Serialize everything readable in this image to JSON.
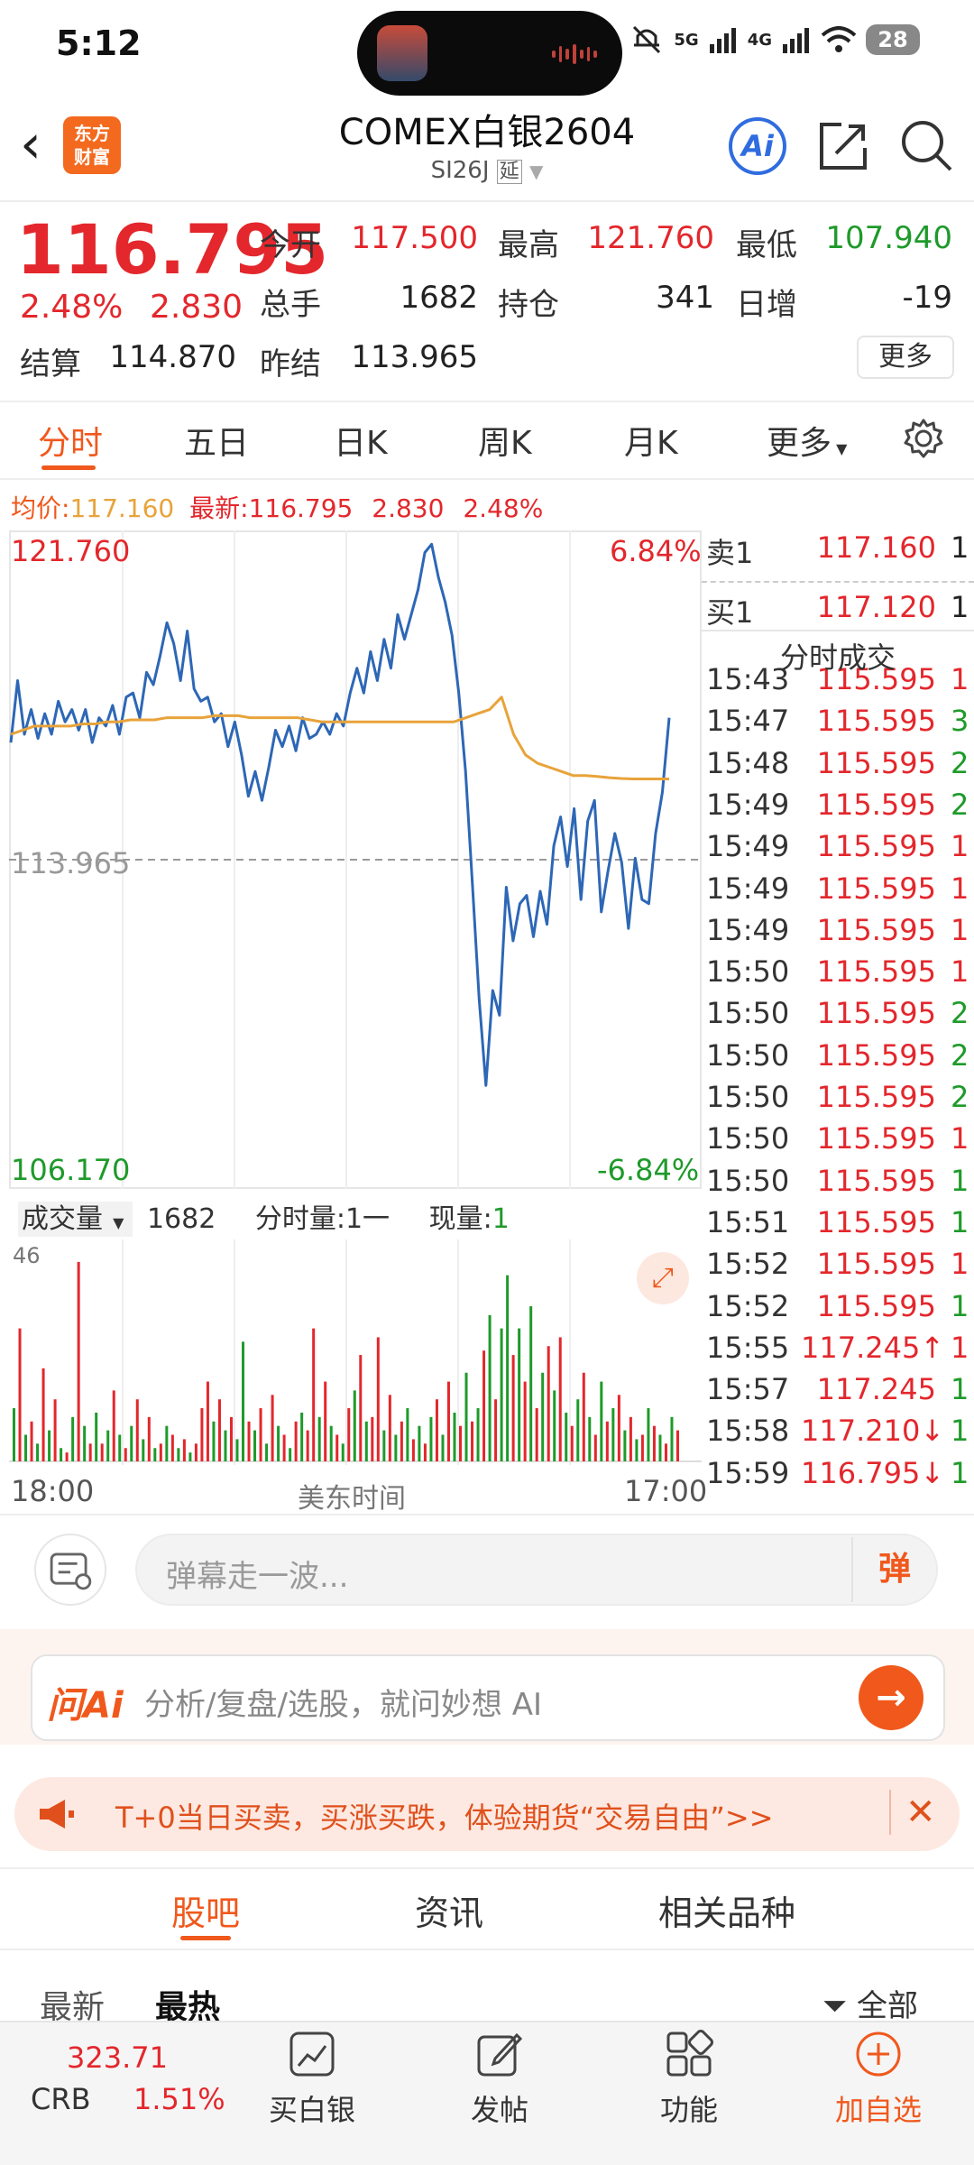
{
  "status_bar": {
    "time": "5:12",
    "network1": "5G",
    "network2": "4G",
    "battery": "28"
  },
  "header": {
    "title": "COMEX白银2604",
    "code": "SI26J",
    "delay_badge": "延",
    "ai_label": "Ai",
    "logo_text": "东方财富"
  },
  "quote": {
    "last": "116.795",
    "pct": "2.48%",
    "change": "2.830",
    "fields": [
      {
        "label": "今开",
        "value": "117.500",
        "color": "red"
      },
      {
        "label": "最高",
        "value": "121.760",
        "color": "red"
      },
      {
        "label": "最低",
        "value": "107.940",
        "color": "green"
      },
      {
        "label": "总手",
        "value": "1682",
        "color": "dark"
      },
      {
        "label": "持仓",
        "value": "341",
        "color": "dark"
      },
      {
        "label": "日增",
        "value": "-19",
        "color": "dark"
      },
      {
        "label": "结算",
        "value": "114.870",
        "color": "dark"
      },
      {
        "label": "昨结",
        "value": "113.965",
        "color": "dark"
      }
    ],
    "more_label": "更多"
  },
  "tabs": [
    "分时",
    "五日",
    "日K",
    "周K",
    "月K",
    "更多"
  ],
  "info_line": {
    "avg_label": "均价:",
    "avg_value": "117.160",
    "last_label": "最新:",
    "last_value": "116.795",
    "change": "2.830",
    "pct": "2.48%"
  },
  "chart_data": {
    "type": "line",
    "title": "",
    "x_start": "18:00",
    "x_end": "17:00",
    "x_center_label": "美东时间",
    "y_top": "121.760",
    "y_bottom": "106.170",
    "y_ref": "113.965",
    "pct_top": "6.84%",
    "pct_bottom": "-6.84%",
    "ylim": [
      106.17,
      121.76
    ],
    "ref_line": 113.965,
    "series": [
      {
        "name": "价格",
        "color": "#2d67b6",
        "values": [
          116.8,
          118.3,
          117.0,
          117.6,
          116.9,
          117.5,
          117.0,
          117.8,
          117.3,
          117.6,
          117.1,
          117.6,
          116.8,
          117.4,
          117.2,
          117.7,
          117.0,
          117.9,
          118.0,
          117.4,
          118.5,
          118.2,
          118.9,
          119.7,
          119.2,
          118.3,
          119.5,
          118.1,
          117.8,
          117.9,
          117.3,
          117.5,
          116.7,
          117.3,
          116.5,
          115.5,
          116.1,
          115.4,
          116.2,
          117.1,
          116.7,
          117.2,
          116.6,
          117.4,
          116.9,
          117.0,
          117.3,
          117.0,
          117.5,
          117.2,
          118.0,
          118.6,
          118.0,
          119.0,
          118.3,
          119.3,
          118.6,
          119.9,
          119.3,
          119.9,
          120.5,
          121.4,
          121.6,
          120.8,
          120.2,
          119.4,
          118.0,
          116.1,
          113.4,
          110.6,
          108.5,
          110.8,
          110.2,
          113.3,
          112.0,
          112.9,
          113.1,
          112.1,
          113.2,
          112.4,
          114.3,
          115.0,
          113.8,
          115.2,
          113.0,
          114.9,
          115.4,
          112.7,
          113.7,
          114.6,
          113.9,
          112.3,
          114.0,
          113.0,
          112.9,
          114.6,
          115.6,
          117.4
        ]
      },
      {
        "name": "均价",
        "color": "#e8a33a",
        "values": [
          117.0,
          117.1,
          117.2,
          117.2,
          117.2,
          117.2,
          117.25,
          117.25,
          117.3,
          117.3,
          117.35,
          117.35,
          117.35,
          117.4,
          117.4,
          117.4,
          117.4,
          117.45,
          117.45,
          117.45,
          117.4,
          117.4,
          117.4,
          117.4,
          117.4,
          117.35,
          117.3,
          117.3,
          117.3,
          117.3,
          117.3,
          117.3,
          117.3,
          117.3,
          117.3,
          117.3,
          117.3,
          117.3,
          117.4,
          117.5,
          117.6,
          117.9,
          117.0,
          116.5,
          116.3,
          116.2,
          116.1,
          116.0,
          116.0,
          115.98,
          115.95,
          115.93,
          115.92,
          115.92,
          115.92,
          115.92
        ]
      }
    ],
    "volume": {
      "label": "成交量",
      "total": "1682",
      "unit_label": "分时量:1一",
      "now_label": "现量:",
      "now_value": "1",
      "max_label": "46",
      "ylim": [
        0,
        46
      ],
      "bars": [
        12,
        30,
        6,
        9,
        4,
        21,
        7,
        14,
        3,
        2,
        10,
        45,
        8,
        4,
        11,
        4,
        7,
        16,
        6,
        3,
        8,
        14,
        5,
        10,
        3,
        4,
        8,
        6,
        3,
        5,
        2,
        4,
        12,
        18,
        9,
        14,
        7,
        10,
        5,
        27,
        9,
        7,
        12,
        4,
        15,
        8,
        6,
        3,
        9,
        11,
        7,
        30,
        10,
        18,
        8,
        6,
        4,
        12,
        16,
        24,
        9,
        10,
        28,
        7,
        15,
        6,
        9,
        12,
        5,
        8,
        4,
        10,
        14,
        6,
        18,
        11,
        8,
        20,
        9,
        12,
        25,
        33,
        14,
        30,
        42,
        24,
        30,
        18,
        35,
        12,
        20,
        26,
        16,
        28,
        11,
        8,
        14,
        20,
        10,
        6,
        18,
        9,
        12,
        15,
        7,
        10,
        5,
        6,
        12,
        8,
        6,
        4,
        10,
        7
      ],
      "colors": [
        "g",
        "r",
        "g",
        "r",
        "g",
        "r",
        "g",
        "r",
        "g",
        "r",
        "g",
        "r",
        "g",
        "r",
        "g",
        "r",
        "g",
        "r",
        "g",
        "r",
        "g",
        "r",
        "g",
        "r",
        "g",
        "r",
        "g",
        "r",
        "g",
        "r",
        "g",
        "r",
        "r",
        "r",
        "g",
        "r",
        "g",
        "r",
        "g",
        "g",
        "r",
        "g",
        "r",
        "g",
        "r",
        "g",
        "r",
        "g",
        "r",
        "g",
        "r",
        "r",
        "g",
        "r",
        "g",
        "r",
        "g",
        "r",
        "g",
        "r",
        "g",
        "r",
        "r",
        "g",
        "r",
        "g",
        "r",
        "g",
        "r",
        "g",
        "r",
        "g",
        "r",
        "g",
        "r",
        "g",
        "r",
        "g",
        "r",
        "g",
        "r",
        "g",
        "r",
        "g",
        "g",
        "r",
        "g",
        "r",
        "g",
        "r",
        "g",
        "r",
        "g",
        "r",
        "g",
        "r",
        "g",
        "r",
        "g",
        "r",
        "g",
        "r",
        "g",
        "r",
        "g",
        "r",
        "g",
        "r",
        "g",
        "r",
        "g",
        "r",
        "g",
        "r"
      ]
    }
  },
  "trades": {
    "ask": {
      "label": "卖1",
      "price": "117.160",
      "vol": "1"
    },
    "bid": {
      "label": "买1",
      "price": "117.120",
      "vol": "1"
    },
    "title": "分时成交",
    "rows": [
      {
        "t": "15:43",
        "p": "115.595",
        "v": "1",
        "c": "red",
        "a": ""
      },
      {
        "t": "15:47",
        "p": "115.595",
        "v": "3",
        "c": "green",
        "a": ""
      },
      {
        "t": "15:48",
        "p": "115.595",
        "v": "2",
        "c": "green",
        "a": ""
      },
      {
        "t": "15:49",
        "p": "115.595",
        "v": "2",
        "c": "green",
        "a": ""
      },
      {
        "t": "15:49",
        "p": "115.595",
        "v": "1",
        "c": "red",
        "a": ""
      },
      {
        "t": "15:49",
        "p": "115.595",
        "v": "1",
        "c": "red",
        "a": ""
      },
      {
        "t": "15:49",
        "p": "115.595",
        "v": "1",
        "c": "red",
        "a": ""
      },
      {
        "t": "15:50",
        "p": "115.595",
        "v": "1",
        "c": "red",
        "a": ""
      },
      {
        "t": "15:50",
        "p": "115.595",
        "v": "2",
        "c": "green",
        "a": ""
      },
      {
        "t": "15:50",
        "p": "115.595",
        "v": "2",
        "c": "green",
        "a": ""
      },
      {
        "t": "15:50",
        "p": "115.595",
        "v": "2",
        "c": "green",
        "a": ""
      },
      {
        "t": "15:50",
        "p": "115.595",
        "v": "1",
        "c": "red",
        "a": ""
      },
      {
        "t": "15:50",
        "p": "115.595",
        "v": "1",
        "c": "green",
        "a": ""
      },
      {
        "t": "15:51",
        "p": "115.595",
        "v": "1",
        "c": "green",
        "a": ""
      },
      {
        "t": "15:52",
        "p": "115.595",
        "v": "1",
        "c": "red",
        "a": ""
      },
      {
        "t": "15:52",
        "p": "115.595",
        "v": "1",
        "c": "green",
        "a": ""
      },
      {
        "t": "15:55",
        "p": "117.245",
        "v": "1",
        "c": "red",
        "a": "↑"
      },
      {
        "t": "15:57",
        "p": "117.245",
        "v": "1",
        "c": "green",
        "a": ""
      },
      {
        "t": "15:58",
        "p": "117.210",
        "v": "1",
        "c": "green",
        "a": "↓"
      },
      {
        "t": "15:59",
        "p": "116.795",
        "v": "1",
        "c": "green",
        "a": "↓"
      }
    ]
  },
  "danmaku": {
    "placeholder": "弹幕走一波...",
    "button": "弹"
  },
  "ask_ai": {
    "logo": "问Ai",
    "placeholder": "分析/复盘/选股，就问妙想 AI"
  },
  "promo": {
    "text": "T+0当日买卖，买涨买跌，体验期货“交易自由”>>"
  },
  "forum_tabs": [
    "股吧",
    "资讯",
    "相关品种"
  ],
  "sort_tabs": [
    "最新",
    "最热"
  ],
  "filter_label": "全部",
  "bottom": {
    "index_value": "323.71",
    "index_name": "CRB",
    "index_pct": "1.51%",
    "nav": [
      "买白银",
      "发帖",
      "功能",
      "加自选"
    ]
  },
  "colors": {
    "accent": "#f0581c",
    "up": "#e3272c",
    "down": "#1e9a2a",
    "price_line": "#2d67b6",
    "avg_line": "#e8a33a"
  }
}
